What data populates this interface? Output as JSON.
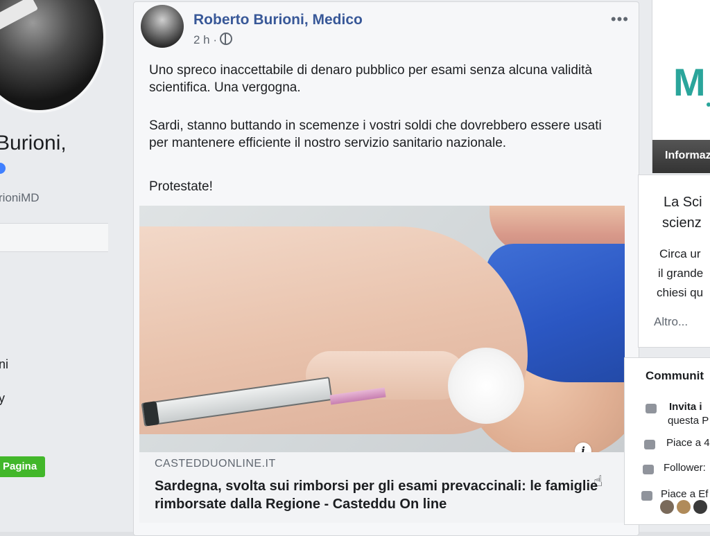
{
  "left": {
    "name_fragment": "Burioni,",
    "handle_fragment": "rioniMD",
    "items": [
      "ni",
      "y"
    ],
    "page_button": "Pagina"
  },
  "post": {
    "author": "Roberto Burioni, Medico",
    "time": "2 h ·",
    "paragraphs": [
      "Uno spreco inaccettabile di denaro pubblico per esami senza alcuna validità scientifica. Una vergogna.",
      "Sardi, stanno buttando in scemenze i vostri soldi che dovrebbero essere usati per mantenere efficiente il nostro servizio sanitario nazionale.",
      "Protestate!"
    ],
    "link": {
      "domain": "CASTEDDUONLINE.IT",
      "title": "Sardegna, svolta sui rimborsi per gli esami prevaccinali: le famiglie rimborsate dalla Regione - Casteddu On line"
    }
  },
  "right": {
    "logo_text": "M",
    "info_bar": "Informaz",
    "about_lines": [
      "La Sci",
      "scienz"
    ],
    "desc_lines": [
      "Circa ur",
      "il grande",
      "chiesi qu"
    ],
    "more": "Altro...",
    "community_title": "Communit",
    "community_items": [
      {
        "icon": "invite-icon",
        "label": "Invita i",
        "sub": "questa P"
      },
      {
        "icon": "like-icon",
        "label": "Piace a 4"
      },
      {
        "icon": "rss-icon",
        "label": "Follower:"
      },
      {
        "icon": "friends-icon",
        "label": "Piace a Ef"
      }
    ]
  },
  "colors": {
    "link_blue": "#385898",
    "green_button": "#42b72a",
    "brand_teal": "#2aa59b"
  }
}
